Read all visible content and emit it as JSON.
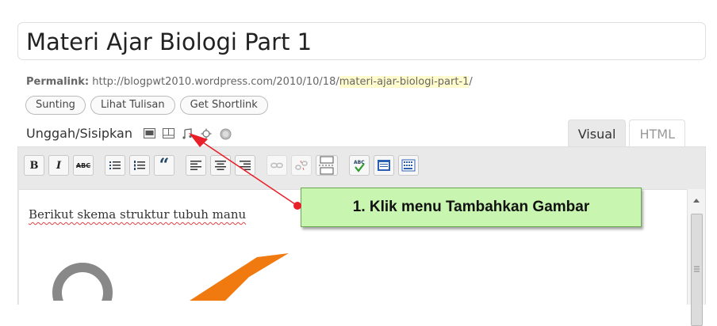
{
  "post": {
    "title": "Materi Ajar Biologi Part 1"
  },
  "permalink": {
    "label": "Permalink:",
    "base": "http://blogpwt2010.wordpress.com/2010/10/18/",
    "slug": "materi-ajar-biologi-part-1",
    "trail": "/"
  },
  "buttons": {
    "edit": "Sunting",
    "view": "Lihat Tulisan",
    "shortlink": "Get Shortlink"
  },
  "upload": {
    "label": "Unggah/Sisipkan",
    "icons": [
      "add-image-icon",
      "add-video-icon",
      "add-audio-icon",
      "add-media-icon",
      "add-poll-icon"
    ]
  },
  "tabs": {
    "visual": "Visual",
    "html": "HTML"
  },
  "toolbar": {
    "bold": "B",
    "italic": "I",
    "strike": "ABC",
    "blockquote": "“"
  },
  "editor": {
    "content_text": "Berikut skema struktur tubuh manu"
  },
  "callout": {
    "text": "1. Klik menu Tambahkan Gambar"
  },
  "colors": {
    "callout_bg": "#c8f5b0",
    "arrow": "#e8202a",
    "slug_highlight": "#fffbcc"
  }
}
